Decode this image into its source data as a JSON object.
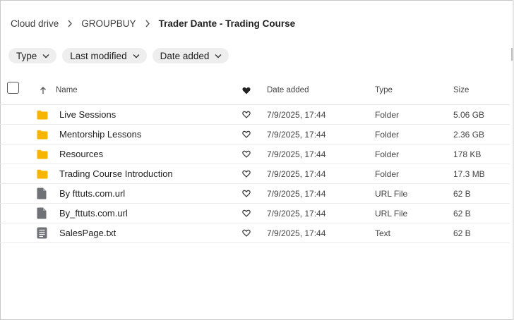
{
  "breadcrumb": {
    "root": "Cloud drive",
    "parent": "GROUPBUY",
    "current": "Trader Dante - Trading Course"
  },
  "filters": [
    {
      "label": "Type"
    },
    {
      "label": "Last modified"
    },
    {
      "label": "Date added"
    }
  ],
  "columns": {
    "name": "Name",
    "date_added": "Date added",
    "type": "Type",
    "size": "Size"
  },
  "rows": [
    {
      "name": "Live Sessions",
      "icon": "folder-icon",
      "date": "7/9/2025, 17:44",
      "type": "Folder",
      "size": "5.06 GB"
    },
    {
      "name": "Mentorship Lessons",
      "icon": "folder-icon",
      "date": "7/9/2025, 17:44",
      "type": "Folder",
      "size": "2.36 GB"
    },
    {
      "name": "Resources",
      "icon": "folder-icon",
      "date": "7/9/2025, 17:44",
      "type": "Folder",
      "size": "178 KB"
    },
    {
      "name": "Trading Course Introduction",
      "icon": "folder-icon",
      "date": "7/9/2025, 17:44",
      "type": "Folder",
      "size": "17.3 MB"
    },
    {
      "name": "By fttuts.com.url",
      "icon": "file-icon",
      "date": "7/9/2025, 17:44",
      "type": "URL File",
      "size": "62 B"
    },
    {
      "name": "By_fttuts.com.url",
      "icon": "file-icon",
      "date": "7/9/2025, 17:44",
      "type": "URL File",
      "size": "62 B"
    },
    {
      "name": "SalesPage.txt",
      "icon": "text-file-icon",
      "date": "7/9/2025, 17:44",
      "type": "Text",
      "size": "62 B"
    }
  ],
  "colors": {
    "folder": "#F7B500",
    "file": "#6E7176"
  }
}
